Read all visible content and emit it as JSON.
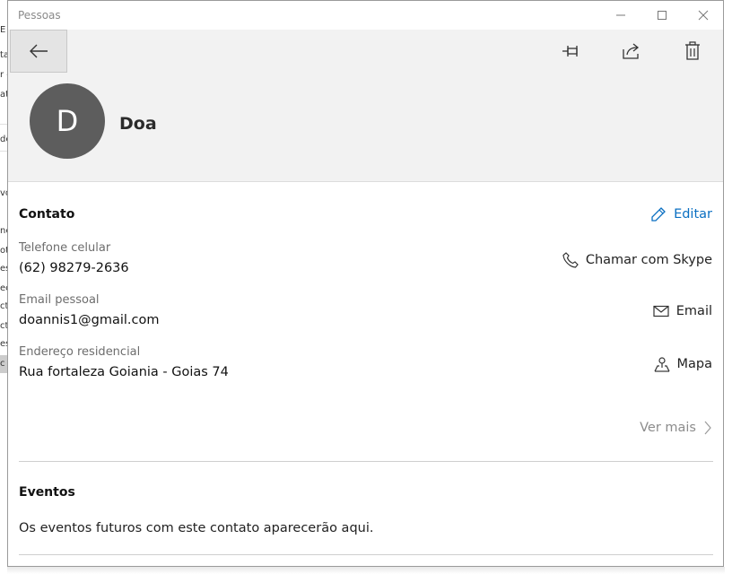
{
  "window": {
    "title": "Pessoas",
    "minimize_icon": "minimize-icon",
    "maximize_icon": "maximize-icon",
    "close_icon": "close-icon"
  },
  "header": {
    "back_icon": "arrow-left-icon",
    "pin_icon": "pin-icon",
    "share_icon": "share-icon",
    "delete_icon": "trash-icon",
    "avatar_initial": "D",
    "avatar_color": "#5d5d5d",
    "name": "Doa"
  },
  "contact": {
    "title": "Contato",
    "edit_label": "Editar",
    "edit_icon": "pencil-icon",
    "accent_color": "#0a6fc2",
    "fields": [
      {
        "label": "Telefone celular",
        "value": "(62) 98279-2636",
        "action_label": "Chamar com Skype",
        "action_icon": "phone-icon"
      },
      {
        "label": "Email pessoal",
        "value": "doannis1@gmail.com",
        "action_label": "Email",
        "action_icon": "mail-icon"
      },
      {
        "label": "Endereço residencial",
        "value": "Rua fortaleza Goiania - Goias 74",
        "action_label": "Mapa",
        "action_icon": "map-pin-icon"
      }
    ],
    "more_label": "Ver mais",
    "more_icon": "chevron-right-icon"
  },
  "events": {
    "title": "Eventos",
    "empty_text": "Os eventos futuros com este contato aparecerão aqui."
  },
  "background_window": {
    "visible_fragments": [
      "E",
      "ta",
      "r c",
      "at",
      "de",
      "vo",
      "ne",
      "ot",
      "es",
      "ec",
      "ct",
      "ct",
      "es",
      "c"
    ]
  }
}
